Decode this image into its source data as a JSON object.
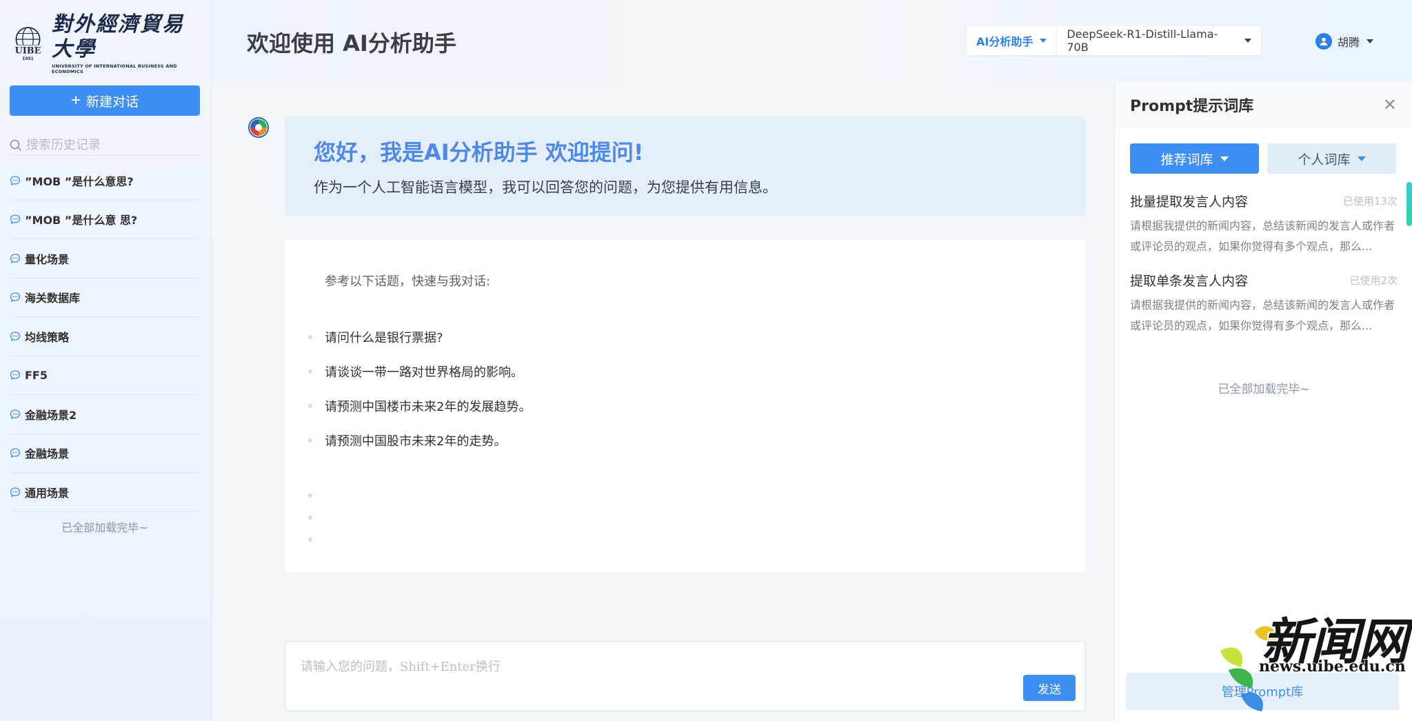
{
  "sidebar": {
    "logo_cn": "對外經濟貿易大學",
    "logo_en": "UNIVERSITY OF INTERNATIONAL BUSINESS AND ECONOMICS",
    "logo_abbr": "UIBE",
    "logo_year": "1951",
    "new_chat_label": "新建对话",
    "search_placeholder": "搜索历史记录",
    "history": [
      {
        "label": "”MOB ”是什么意思?"
      },
      {
        "label": "”MOB ”是什么意 思?"
      },
      {
        "label": "量化场景"
      },
      {
        "label": "海关数据库"
      },
      {
        "label": "均线策略"
      },
      {
        "label": "FF5"
      },
      {
        "label": "金融场景2"
      },
      {
        "label": "金融场景"
      },
      {
        "label": "通用场景"
      }
    ],
    "loaded_text": "已全部加载完毕~"
  },
  "header": {
    "title": "欢迎使用 AI分析助手",
    "assistant_label": "AI分析助手",
    "model_label": "DeepSeek-R1-Distill-Llama-70B",
    "user_name": "胡腾"
  },
  "main": {
    "welcome_title": "您好，我是AI分析助手 欢迎提问!",
    "welcome_sub": "作为一个人工智能语言模型，我可以回答您的问题，为您提供有用信息。",
    "topics_intro": "参考以下话题，快速与我对话:",
    "topics": [
      {
        "label": "请问什么是银行票据?"
      },
      {
        "label": "请谈谈一带一路对世界格局的影响。"
      },
      {
        "label": "请预测中国楼市未来2年的发展趋势。"
      },
      {
        "label": "请预测中国股市未来2年的走势。"
      }
    ],
    "input_placeholder": "请输入您的问题，Shift+Enter换行",
    "send_label": "发送"
  },
  "prompt_panel": {
    "title": "Prompt提示词库",
    "tab_recommended": "推荐词库",
    "tab_personal": "个人词库",
    "items": [
      {
        "title": "批量提取发言人内容",
        "uses": "已使用13次",
        "desc": "请根据我提供的新闻内容，总结该新闻的发言人或作者或评论员的观点，如果你觉得有多个观点，那么..."
      },
      {
        "title": "提取单条发言人内容",
        "uses": "已使用2次",
        "desc": "请根据我提供的新闻内容，总结该新闻的发言人或作者或评论员的观点，如果你觉得有多个观点，那么..."
      }
    ],
    "loaded_text": "已全部加载完毕~",
    "manage_label": "管理Prompt库"
  },
  "watermark": {
    "cn": "新闻网",
    "url": "news.uibe.edu.cn"
  },
  "colors": {
    "primary": "#3d8ff2",
    "accent_text": "#4f89e8",
    "welcome_bg": "#e5eefb"
  }
}
